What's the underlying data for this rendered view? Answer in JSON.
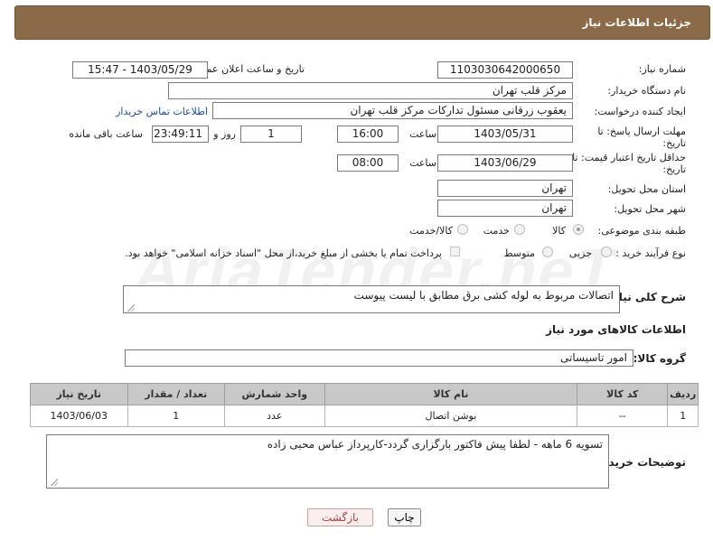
{
  "header": {
    "title": "جزئیات اطلاعات نیاز"
  },
  "form": {
    "need_number": {
      "label": "شماره نیاز:",
      "value": "1103030642000650"
    },
    "announce_datetime": {
      "label": "تاریخ و ساعت اعلان عمومی:",
      "value": "1403/05/29 - 15:47"
    },
    "buyer_org": {
      "label": "نام دستگاه خریدار:",
      "value": "مرکز قلب تهران"
    },
    "requester": {
      "label": "ایجاد کننده درخواست:",
      "value": "یعقوب زرقانی مسئول تدارکات مرکز قلب تهران",
      "contact_link": "اطلاعات تماس خریدار"
    },
    "reply_deadline": {
      "label_line1": "مهلت ارسال پاسخ: تا",
      "label_line2": "تاریخ:",
      "date": "1403/05/31",
      "time_label": "ساعت",
      "time": "16:00",
      "days_value": "1",
      "days_label": "روز و",
      "remaining_time": "23:49:11",
      "remaining_label": "ساعت باقی مانده"
    },
    "price_validity": {
      "label_line1": "حداقل تاریخ اعتبار قیمت: تا",
      "label_line2": "تاریخ:",
      "date": "1403/06/29",
      "time_label": "ساعت",
      "time": "08:00"
    },
    "delivery_province": {
      "label": "استان محل تحویل:",
      "value": "تهران"
    },
    "delivery_city": {
      "label": "شهر محل تحویل:",
      "value": "تهران"
    },
    "subject_class": {
      "label": "طبقه بندی موضوعی:",
      "options": [
        "کالا",
        "خدمت",
        "کالا/خدمت"
      ],
      "selected": "کالا"
    },
    "purchase_type": {
      "label": "نوع فرآیند خرید :",
      "options": [
        "جزیی",
        "متوسط"
      ],
      "payment_note": "پرداخت تمام یا بخشی از مبلغ خرید،از محل \"اسناد خزانه اسلامی\" خواهد بود."
    }
  },
  "description": {
    "label": "شرح کلی نیاز:",
    "value": "اتصالات مربوط به لوله کشی برق مطابق با لیست پیوست"
  },
  "goods_section": {
    "title": "اطلاعات کالاهای مورد نیاز"
  },
  "goods_group": {
    "label": "گروه کالا:",
    "value": "امور تاسیساتی"
  },
  "items_table": {
    "columns": [
      "ردیف",
      "کد کالا",
      "نام کالا",
      "واحد شمارش",
      "تعداد / مقدار",
      "تاریخ نیاز"
    ],
    "rows": [
      [
        "1",
        "--",
        "بوشن اتصال",
        "عدد",
        "1",
        "1403/06/03"
      ]
    ]
  },
  "buyer_notes": {
    "label": "توضیحات خریدار:",
    "value": "تسویه 6 ماهه - لطفا پیش فاکتور بارگزاری گردد-کارپرداز عباس محبی زاده"
  },
  "buttons": {
    "print": "چاپ",
    "back": "بازگشت"
  },
  "watermark": {
    "text": "AriaTender.neT"
  }
}
